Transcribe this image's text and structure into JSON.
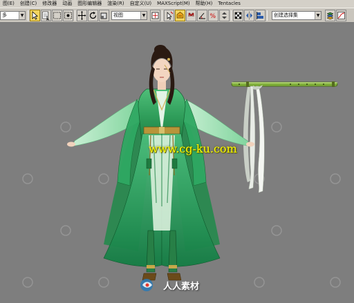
{
  "menu": {
    "items": [
      "图(E)",
      "创建(C)",
      "修改器",
      "动画",
      "图形编辑器",
      "渲染(R)",
      "自定义(U)",
      "MAXScript(M)",
      "帮助(H)",
      "Tentacles"
    ]
  },
  "toolbar": {
    "filter_dropdown": "多",
    "view_dropdown": "视图",
    "selection_set_dropdown": "创建选择集"
  },
  "viewport": {
    "watermark_url": "www.cg-ku.com",
    "watermark_brand": "人人素材"
  },
  "colors": {
    "highlight_button": "#f2d560",
    "viewport_background": "#7e7e7e",
    "robe_green": "#2f9d5a",
    "watermark_text": "#ffff00"
  }
}
